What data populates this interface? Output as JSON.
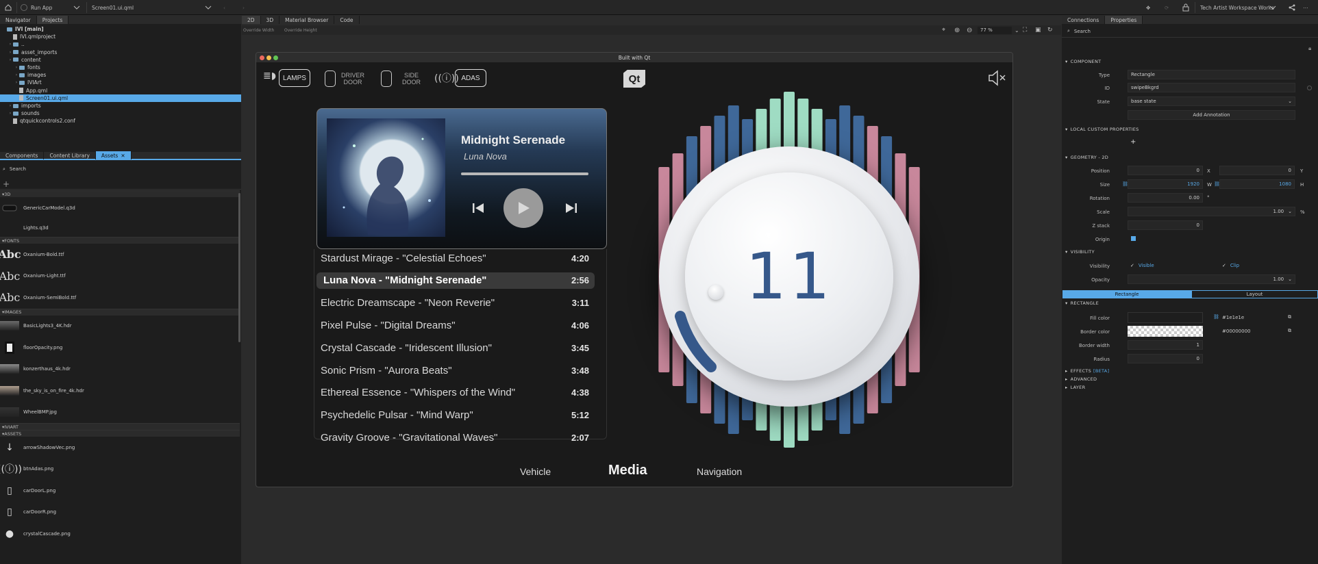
{
  "topbar": {
    "run_app": "Run App",
    "file": "Screen01.ui.qml",
    "workspace": "Tech Artist Workspace Works"
  },
  "navigator": {
    "tabs": [
      "Navigator",
      "Projects"
    ],
    "tree": [
      {
        "label": "IVI [main]",
        "indent": 0,
        "type": "root"
      },
      {
        "label": "IVI.qmlproject",
        "indent": 1,
        "type": "file"
      },
      {
        "label": "..",
        "indent": 1,
        "type": "folder"
      },
      {
        "label": "asset_imports",
        "indent": 1,
        "type": "folder"
      },
      {
        "label": "content",
        "indent": 1,
        "type": "folder"
      },
      {
        "label": "fonts",
        "indent": 2,
        "type": "folder"
      },
      {
        "label": "images",
        "indent": 2,
        "type": "folder"
      },
      {
        "label": "IVIArt",
        "indent": 2,
        "type": "folder"
      },
      {
        "label": "App.qml",
        "indent": 2,
        "type": "file"
      },
      {
        "label": "Screen01.ui.qml",
        "indent": 2,
        "type": "file",
        "selected": true
      },
      {
        "label": "imports",
        "indent": 1,
        "type": "folder"
      },
      {
        "label": "sounds",
        "indent": 1,
        "type": "folder"
      },
      {
        "label": "qtquickcontrols2.conf",
        "indent": 1,
        "type": "file"
      }
    ]
  },
  "library": {
    "tabs": [
      "Components",
      "Content Library",
      "Assets"
    ],
    "search_placeholder": "Search",
    "sections": {
      "d3": "3D",
      "fonts": "FONTS",
      "images": "IMAGES",
      "iviart": "IVIART",
      "assets": "ASSETS"
    },
    "items_3d": [
      "GenericCarModel.q3d",
      "Lights.q3d"
    ],
    "fonts": [
      "Oxanium-Bold.ttf",
      "Oxanium-Light.ttf",
      "Oxanium-SemiBold.ttf"
    ],
    "font_sample": "Abc",
    "images": [
      "BasicLights3_4K.hdr",
      "floorOpacity.png",
      "konzerthaus_4k.hdr",
      "the_sky_is_on_fire_4k.hdr",
      "WheelBMP.jpg"
    ],
    "assets": [
      "arrowShadowVec.png",
      "btnAdas.png",
      "carDoorL.png",
      "carDoorR.png",
      "crystalCascade.png"
    ]
  },
  "editor": {
    "tabs": [
      "2D",
      "3D",
      "Material Browser",
      "Code"
    ],
    "override_width": "Override Width",
    "override_height": "Override Height",
    "zoom": "77 %"
  },
  "app": {
    "window_title": "Built with Qt",
    "lamps": "LAMPS",
    "driver_door": [
      "DRIVER",
      "DOOR"
    ],
    "side_door": [
      "SIDE",
      "DOOR"
    ],
    "adas": "ADAS",
    "qt_logo": "Qt",
    "now_playing": {
      "title": "Midnight Serenade",
      "artist": "Luna Nova",
      "progress": 1.0
    },
    "playlist": [
      {
        "name": "Stardust Mirage - \"Celestial Echoes\"",
        "dur": "4:20"
      },
      {
        "name": "Luna Nova - \"Midnight Serenade\"",
        "dur": "2:56",
        "selected": true
      },
      {
        "name": "Electric Dreamscape - \"Neon Reverie\"",
        "dur": "3:11"
      },
      {
        "name": "Pixel Pulse - \"Digital Dreams\"",
        "dur": "4:06"
      },
      {
        "name": "Crystal Cascade - \"Iridescent Illusion\"",
        "dur": "3:45"
      },
      {
        "name": "Sonic Prism - \"Aurora Beats\"",
        "dur": "3:48"
      },
      {
        "name": "Ethereal Essence - \"Whispers of the Wind\"",
        "dur": "4:38"
      },
      {
        "name": "Psychedelic Pulsar - \"Mind Warp\"",
        "dur": "5:12"
      },
      {
        "name": "Gravity Groove - \"Gravitational Waves\"",
        "dur": "2:07"
      }
    ],
    "volume": "11",
    "nav": {
      "vehicle": "Vehicle",
      "media": "Media",
      "navigation": "Navigation"
    },
    "colors": {
      "pink": "#c8879b",
      "blue": "#3f6899",
      "mint": "#9fdcc3"
    }
  },
  "properties": {
    "tabs": [
      "Connections",
      "Properties"
    ],
    "search_placeholder": "Search",
    "component": {
      "header": "COMPONENT",
      "type_label": "Type",
      "type": "Rectangle",
      "id_label": "ID",
      "id": "swipeBkgrd",
      "state_label": "State",
      "state": "base state",
      "add_annotation": "Add Annotation"
    },
    "local_custom": {
      "header": "LOCAL CUSTOM PROPERTIES",
      "add": "+"
    },
    "geometry": {
      "header": "GEOMETRY - 2D",
      "position_label": "Position",
      "x": "0",
      "x_label": "X",
      "y": "0",
      "y_label": "Y",
      "size_label": "Size",
      "w": "1920",
      "w_label": "W",
      "h": "1080",
      "h_label": "H",
      "rotation_label": "Rotation",
      "rotation": "0.00",
      "rotation_unit": "°",
      "scale_label": "Scale",
      "scale": "1.00",
      "scale_unit": "%",
      "z_label": "Z stack",
      "z": "0",
      "origin_label": "Origin"
    },
    "visibility": {
      "header": "VISIBILITY",
      "visibility_label": "Visibility",
      "visible": "Visible",
      "clip": "Clip",
      "opacity_label": "Opacity",
      "opacity": "1.00"
    },
    "subtabs": [
      "Rectangle",
      "Layout"
    ],
    "rectangle": {
      "header": "RECTANGLE",
      "fill_label": "Fill color",
      "fill": "#1e1e1e",
      "border_label": "Border color",
      "border": "#00000000",
      "border_width_label": "Border width",
      "border_width": "1",
      "radius_label": "Radius",
      "radius": "0"
    },
    "effects": "EFFECTS",
    "effects_beta": "[BETA]",
    "advanced": "ADVANCED",
    "layer": "LAYER"
  }
}
